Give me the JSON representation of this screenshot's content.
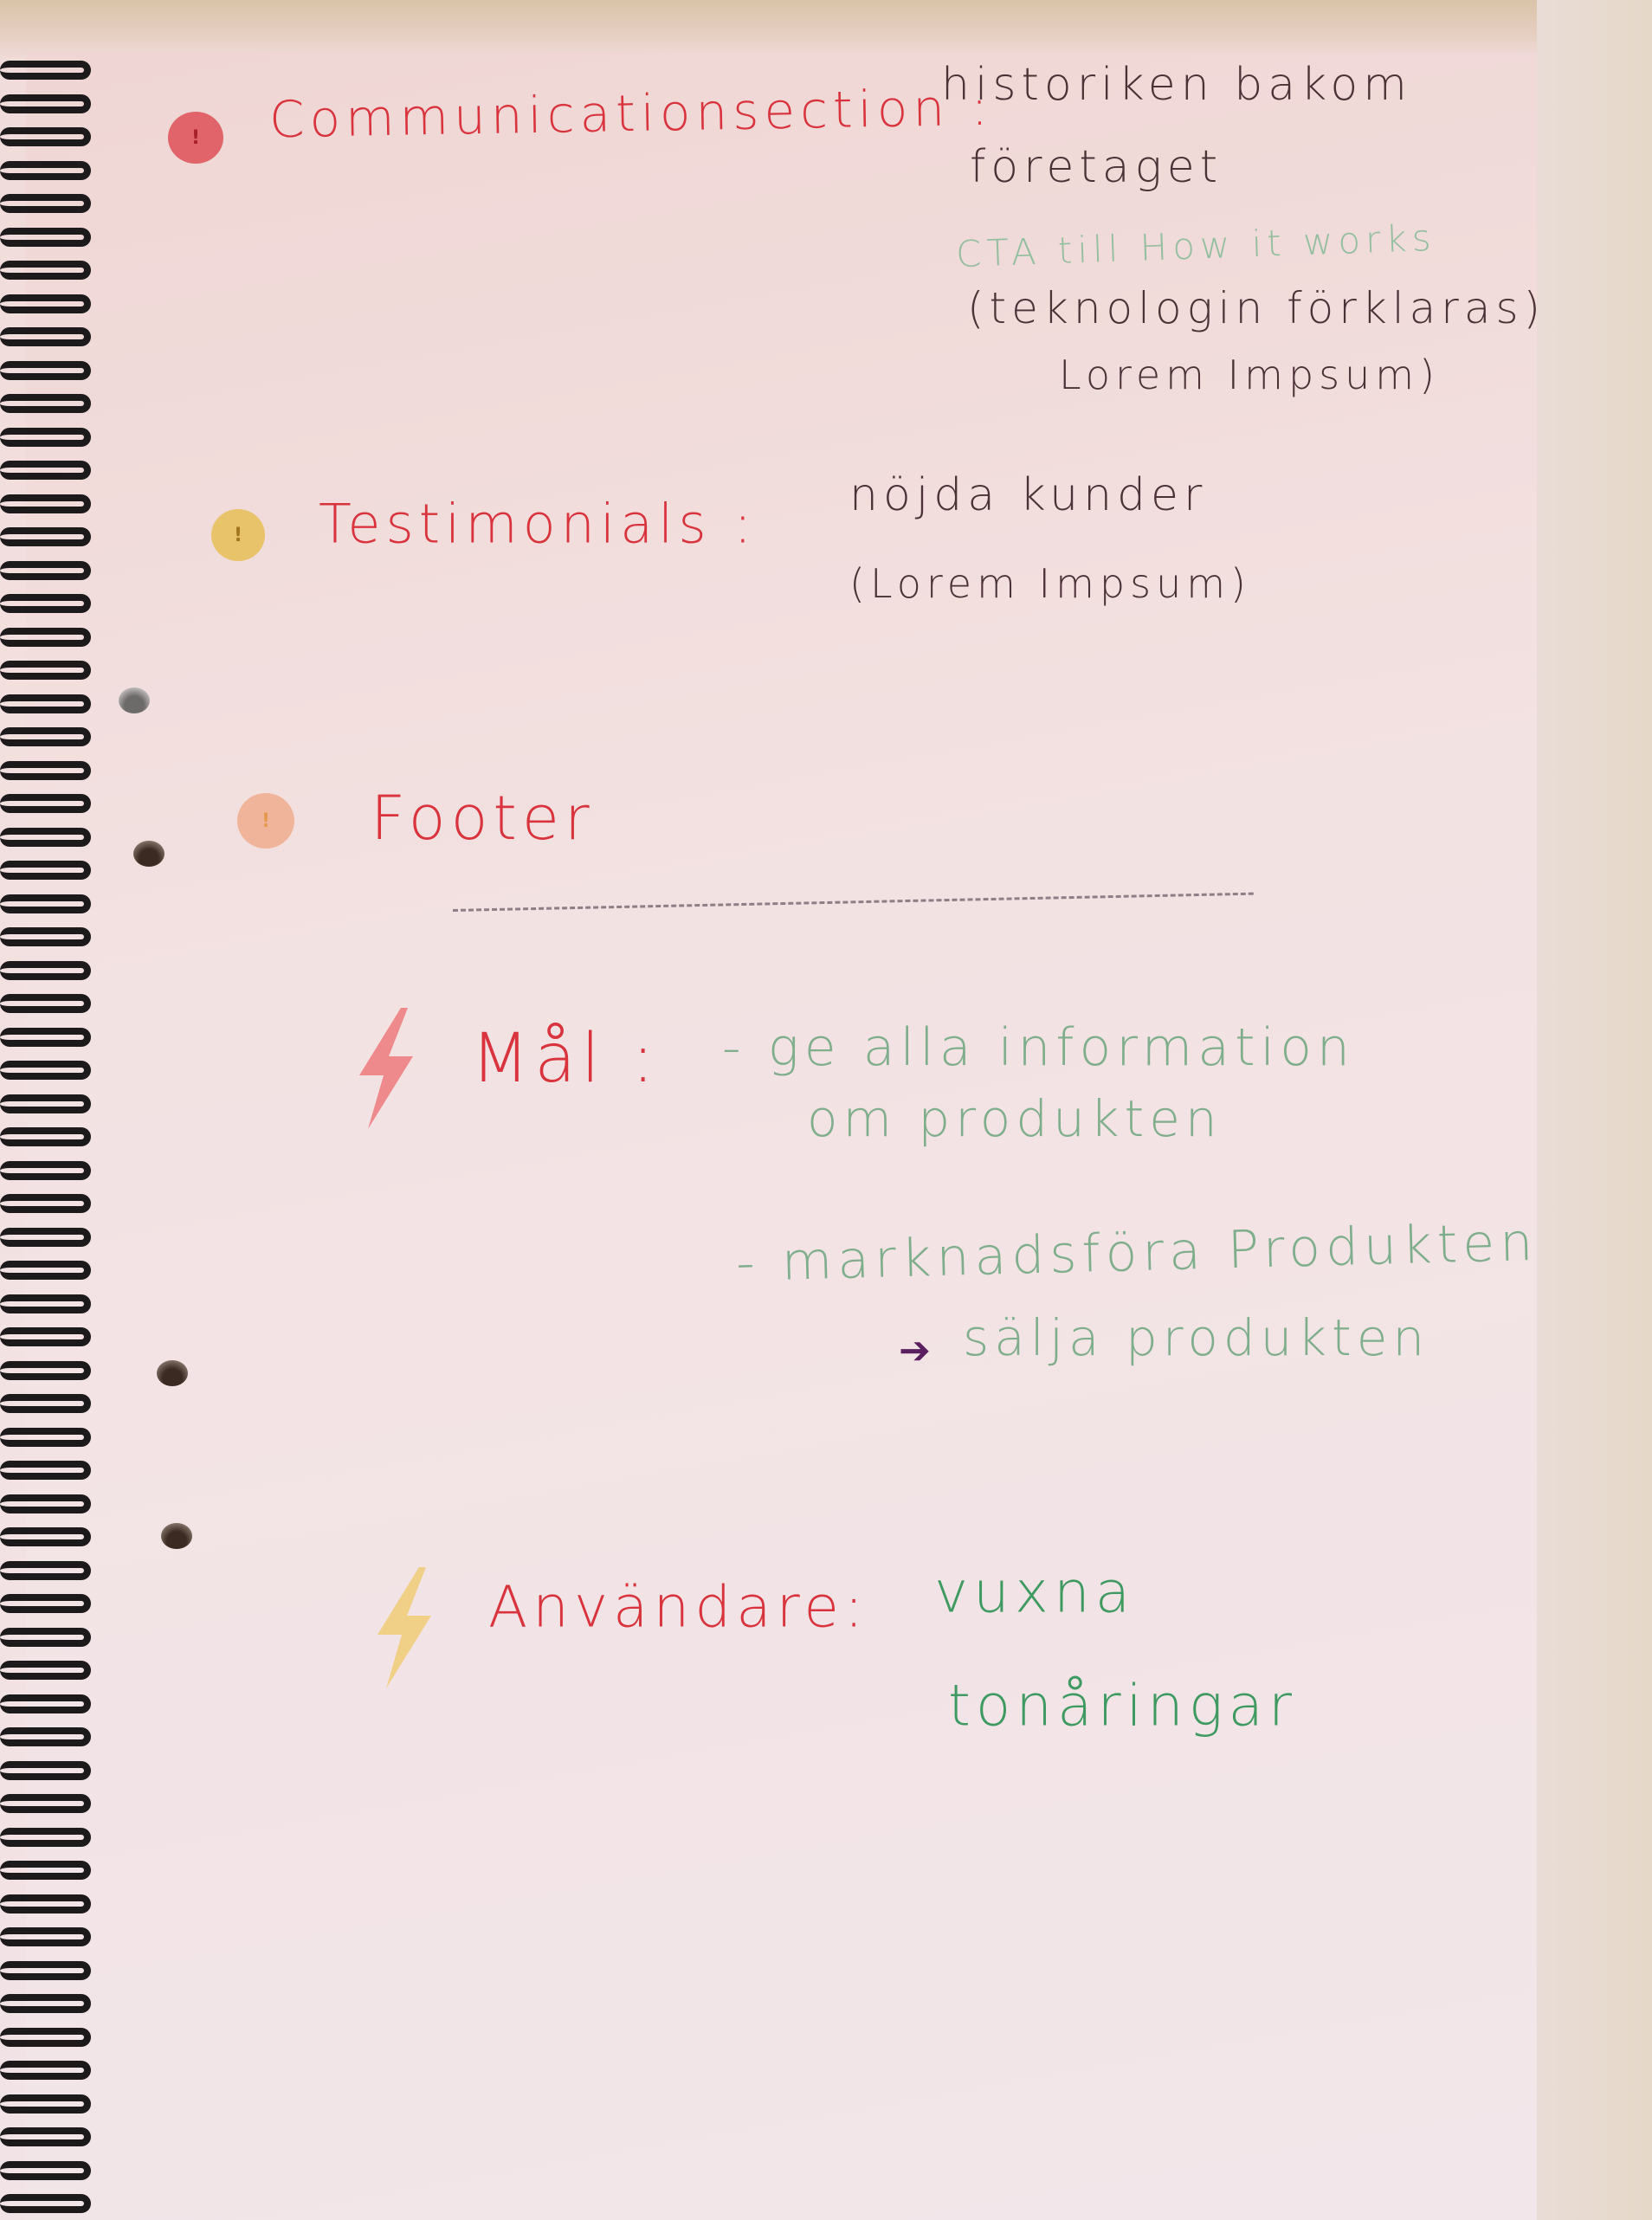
{
  "notes": {
    "communication": {
      "heading": "Communicationsection :",
      "lines": [
        "historiken bakom",
        "företaget",
        "CTA till How it works",
        "(teknologin förklaras)",
        "Lorem Impsum)"
      ]
    },
    "testimonials": {
      "heading": "Testimonials :",
      "lines": [
        "nöjda kunder",
        "(Lorem Impsum)"
      ]
    },
    "footer": {
      "heading": "Footer"
    },
    "goal": {
      "heading": "Mål :",
      "lines": [
        "- ge alla information",
        "om produkten",
        "- marknadsföra Produkten",
        "säljа produkten"
      ]
    },
    "users": {
      "heading": "Användare:",
      "lines": [
        "vuxna",
        "tonåringar"
      ]
    }
  },
  "icons": [
    "exclamation-circle-icon",
    "lightning-icon",
    "arrow-right-icon"
  ],
  "colors": {
    "red": "#d9343d",
    "yellow": "#e8c36a",
    "peach": "#f0b49a",
    "green": "#3f9a62",
    "ink": "#4a3236",
    "purple": "#5a1f5e"
  }
}
